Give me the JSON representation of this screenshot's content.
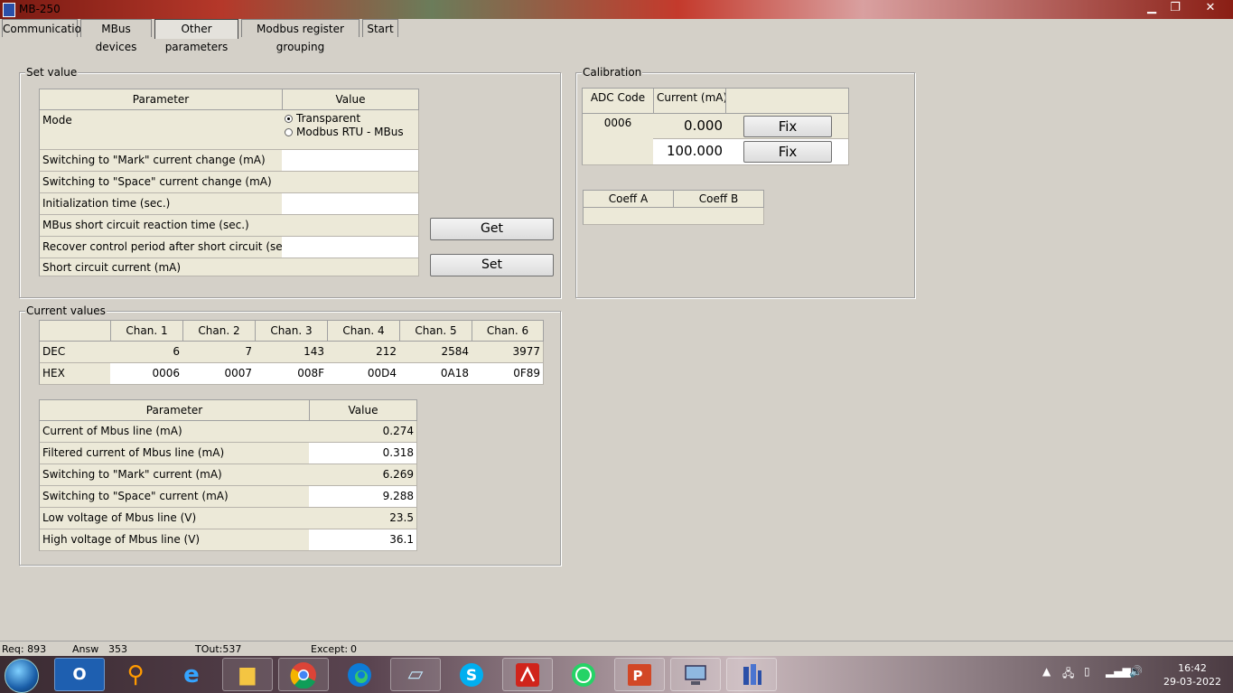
{
  "window": {
    "title": "MB-250",
    "min": "▁",
    "max": "❐",
    "close": "✕"
  },
  "tabs": [
    "Communication",
    "MBus devices",
    "Other parameters",
    "Modbus register grouping",
    "Start"
  ],
  "set_value": {
    "title": "Set value",
    "header_param": "Parameter",
    "header_value": "Value",
    "mode_label": "Mode",
    "mode_options": [
      "Transparent",
      "Modbus RTU - MBus"
    ],
    "mode_selected": "Transparent",
    "rows": [
      "Switching to \"Mark\" current change (mA)",
      "Switching to \"Space\" current change (mA)",
      "Initialization time (sec.)",
      "MBus short circuit reaction time (sec.)",
      "Recover control period after short circuit (sec.)",
      "Short circuit current (mA)"
    ],
    "get_label": "Get",
    "set_label": "Set"
  },
  "calibration": {
    "title": "Calibration",
    "col_adc": "ADC Code",
    "col_current": "Current (mA)",
    "adc_value": "0006",
    "currents": [
      "0.000",
      "100.000"
    ],
    "fix_label": "Fix",
    "coeff_a": "Coeff A",
    "coeff_b": "Coeff B"
  },
  "current_values": {
    "title": "Current values",
    "channels": [
      "Chan. 1",
      "Chan. 2",
      "Chan. 3",
      "Chan. 4",
      "Chan. 5",
      "Chan. 6"
    ],
    "dec_label": "DEC",
    "hex_label": "HEX",
    "dec": [
      "6",
      "7",
      "143",
      "212",
      "2584",
      "3977"
    ],
    "hex": [
      "0006",
      "0007",
      "008F",
      "00D4",
      "0A18",
      "0F89"
    ],
    "header_param": "Parameter",
    "header_value": "Value",
    "params": [
      {
        "label": "Current of Mbus line (mA)",
        "value": "0.274"
      },
      {
        "label": "Filtered current of Mbus line (mA)",
        "value": "0.318"
      },
      {
        "label": "Switching to \"Mark\" current (mA)",
        "value": "6.269"
      },
      {
        "label": "Switching to \"Space\" current (mA)",
        "value": "9.288"
      },
      {
        "label": "Low voltage of Mbus line (V)",
        "value": "23.5"
      },
      {
        "label": "High voltage of Mbus line (V)",
        "value": "36.1"
      }
    ]
  },
  "status": {
    "req_label": "Req: 893",
    "answ_label": "Answ",
    "answ_value": "353",
    "tout": "TOut:537",
    "except_label": "Except:",
    "except_value": "0"
  },
  "taskbar": {
    "apps": [
      "outlook-icon",
      "search-icon",
      "internet-explorer-icon",
      "file-explorer-icon",
      "chrome-icon",
      "edge-icon",
      "notepad-icon",
      "skype-icon",
      "acrobat-icon",
      "whatsapp-icon",
      "powerpoint-icon",
      "network-computer-icon",
      "mb250-app-icon"
    ],
    "time": "16:42",
    "date": "29-03-2022"
  }
}
